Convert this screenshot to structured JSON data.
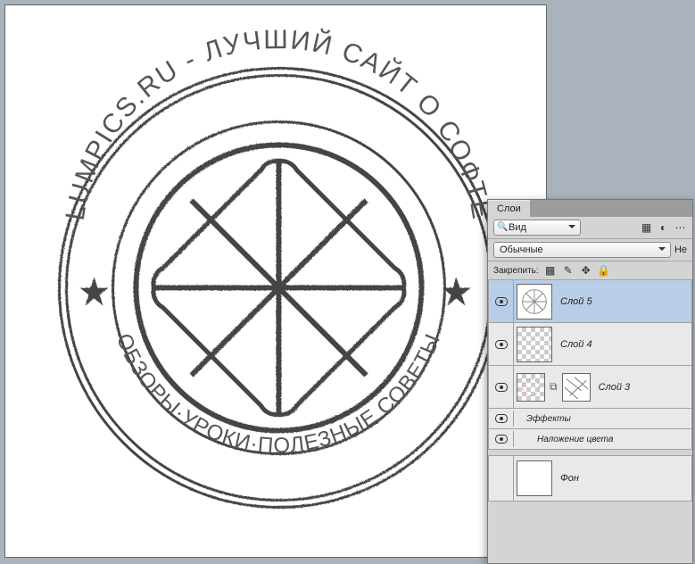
{
  "panel": {
    "title": "Слои",
    "search_label": "Вид",
    "blend_mode": "Обычные",
    "opacity_label": "Не",
    "lock_label": "Закрепить:"
  },
  "stamp": {
    "top_text": "LUMPICS.RU - ЛУЧШИЙ САЙТ О СОФТЕ",
    "bottom_text": "ОБЗОРЫ·УРОКИ·ПОЛЕЗНЫЕ СОВЕТЫ"
  },
  "layers": [
    {
      "name": "Слой 5",
      "selected": true,
      "visible": true,
      "thumb": "stamp"
    },
    {
      "name": "Слой 4",
      "selected": false,
      "visible": true,
      "thumb": "checker"
    },
    {
      "name": "Слой 3",
      "selected": false,
      "visible": true,
      "thumb": "double"
    }
  ],
  "effects": {
    "label": "Эффекты",
    "sub": "Наложение цвета"
  },
  "background": {
    "name": "Фон"
  }
}
